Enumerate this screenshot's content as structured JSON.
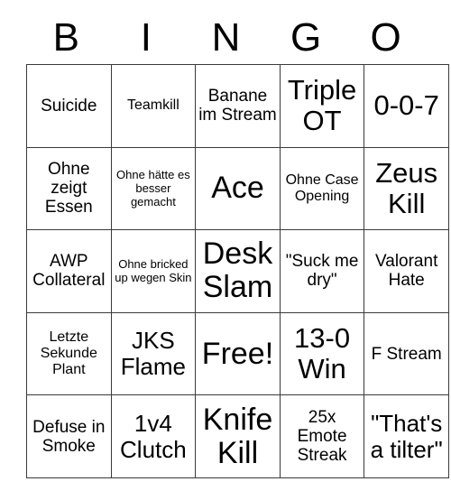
{
  "card": {
    "type": "bingo-card",
    "header_letters": [
      "B",
      "I",
      "N",
      "G",
      "O"
    ],
    "rows": 5,
    "columns": 5,
    "border_color": "#3a3a3a",
    "background_color": "#ffffff",
    "text_color": "#000000",
    "free_space": {
      "row": 3,
      "column": 2,
      "label": "Free!"
    },
    "cells": [
      [
        {
          "text": "Suicide",
          "size": "md"
        },
        {
          "text": "Teamkill",
          "size": "sm"
        },
        {
          "text": "Banane im Stream",
          "size": "md"
        },
        {
          "text": "Triple OT",
          "size": "xl"
        },
        {
          "text": "0-0-7",
          "size": "xl"
        }
      ],
      [
        {
          "text": "Ohne zeigt Essen",
          "size": "md"
        },
        {
          "text": "Ohne hätte es besser gemacht",
          "size": "xs"
        },
        {
          "text": "Ace",
          "size": "xxl"
        },
        {
          "text": "Ohne Case Opening",
          "size": "sm"
        },
        {
          "text": "Zeus Kill",
          "size": "xl"
        }
      ],
      [
        {
          "text": "AWP Collateral",
          "size": "md"
        },
        {
          "text": "Ohne bricked up wegen Skin",
          "size": "xs"
        },
        {
          "text": "Desk Slam",
          "size": "xxl"
        },
        {
          "text": "\"Suck me dry\"",
          "size": "md"
        },
        {
          "text": "Valorant Hate",
          "size": "md"
        }
      ],
      [
        {
          "text": "Letzte Sekunde Plant",
          "size": "sm"
        },
        {
          "text": "JKS Flame",
          "size": "lg"
        },
        {
          "text": "Free!",
          "size": "xxl"
        },
        {
          "text": "13-0 Win",
          "size": "xl"
        },
        {
          "text": "F Stream",
          "size": "md"
        }
      ],
      [
        {
          "text": "Defuse in Smoke",
          "size": "md"
        },
        {
          "text": "1v4 Clutch",
          "size": "lg"
        },
        {
          "text": "Knife Kill",
          "size": "xxl"
        },
        {
          "text": "25x Emote Streak",
          "size": "md"
        },
        {
          "text": "\"That's a tilter\"",
          "size": "lg"
        }
      ]
    ]
  }
}
